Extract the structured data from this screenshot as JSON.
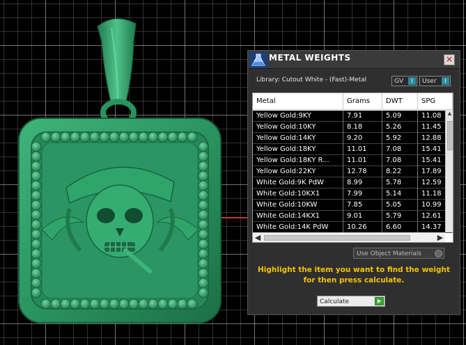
{
  "panel": {
    "title": "METAL WEIGHTS",
    "close_glyph": "×",
    "library_label": "Library: Cutout White - (Fast)-Metal",
    "toggles": [
      {
        "label": "GV",
        "knob": "I"
      },
      {
        "label": "User",
        "knob": "I"
      }
    ]
  },
  "table": {
    "headers": [
      "Metal",
      "Grams",
      "DWT",
      "SPG"
    ],
    "rows": [
      [
        "Yellow Gold:9KY",
        "7.91",
        "5.09",
        "11.08"
      ],
      [
        "Yellow Gold:10KY",
        "8.18",
        "5.26",
        "11.45"
      ],
      [
        "Yellow Gold:14KY",
        "9.20",
        "5.92",
        "12.88"
      ],
      [
        "Yellow Gold:18KY",
        "11.01",
        "7.08",
        "15.41"
      ],
      [
        "Yellow Gold:18KY R...",
        "11.01",
        "7.08",
        "15.41"
      ],
      [
        "Yellow Gold:22KY",
        "12.78",
        "8.22",
        "17.89"
      ],
      [
        "White Gold:9K PdW",
        "8.99",
        "5.78",
        "12.59"
      ],
      [
        "White Gold:10KX1",
        "7.99",
        "5.14",
        "11.18"
      ],
      [
        "White Gold:10KW",
        "7.85",
        "5.05",
        "10.99"
      ],
      [
        "White Gold:14KX1",
        "9.01",
        "5.79",
        "12.61"
      ],
      [
        "White Gold:14K PdW",
        "10.26",
        "6.60",
        "14.37"
      ]
    ],
    "scroll_left": "◀",
    "scroll_right": "▶",
    "scroll_up": "▲",
    "scroll_down": "▼"
  },
  "use_object_materials": "Use Object Materials",
  "hint": "Highlight the item you want to find the weight for then press calculate.",
  "calculate_label": "Calculate",
  "colors": {
    "model_green": "#2d9a64",
    "hint_yellow": "#f3c300",
    "panel_bg": "#2f2f2f",
    "accent_teal": "#2a8ea0"
  },
  "icons": [
    "metal-weights-flask-icon",
    "close-icon",
    "calculate-play-icon"
  ]
}
